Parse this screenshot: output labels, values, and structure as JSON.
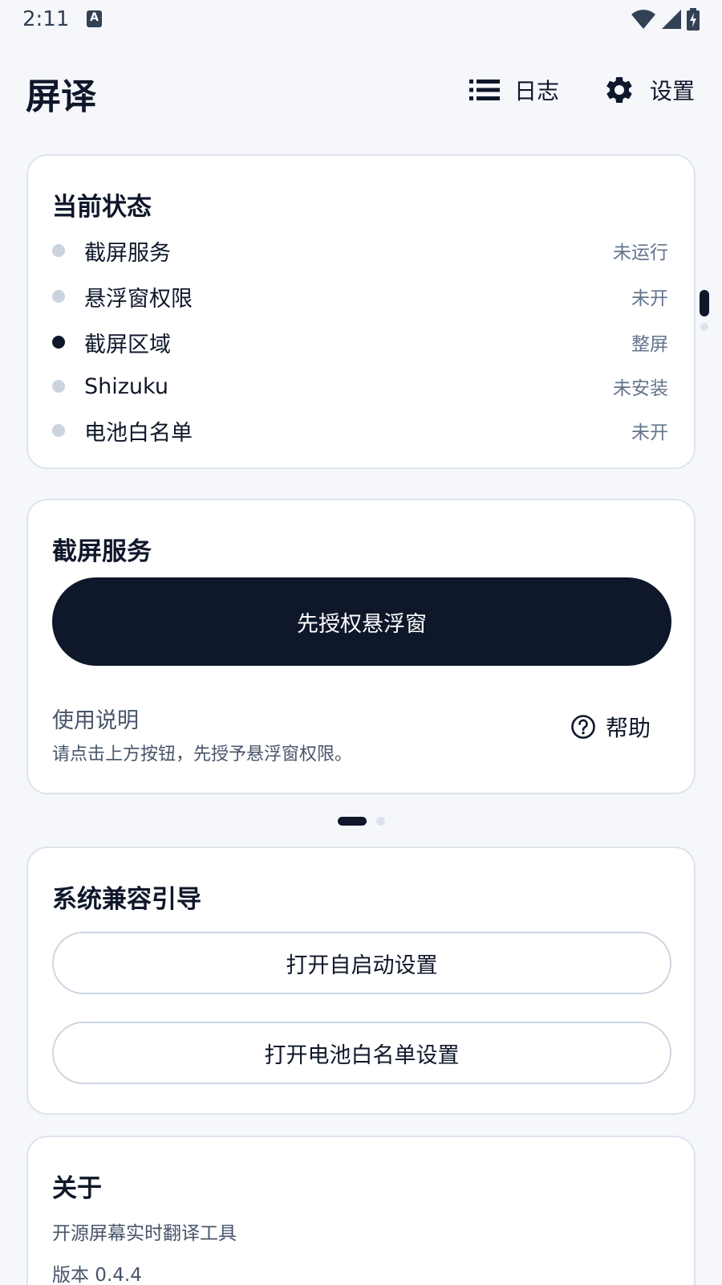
{
  "status_bar": {
    "time": "2:11",
    "notification_letter": "A"
  },
  "header": {
    "title": "屏译",
    "log_label": "日志",
    "settings_label": "设置"
  },
  "status_card": {
    "title": "当前状态",
    "rows": [
      {
        "label": "截屏服务",
        "value": "未运行",
        "active": false
      },
      {
        "label": "悬浮窗权限",
        "value": "未开",
        "active": false
      },
      {
        "label": "截屏区域",
        "value": "整屏",
        "active": true
      },
      {
        "label": "Shizuku",
        "value": "未安装",
        "active": false
      },
      {
        "label": "电池白名单",
        "value": "未开",
        "active": false
      }
    ]
  },
  "service_card": {
    "title": "截屏服务",
    "primary_button": "先授权悬浮窗",
    "info_title": "使用说明",
    "info_text": "请点击上方按钮，先授予悬浮窗权限。",
    "help_label": "帮助"
  },
  "pager": {
    "pages": 2,
    "current": 1
  },
  "compat_card": {
    "title": "系统兼容引导",
    "autostart_button": "打开自启动设置",
    "battery_button": "打开电池白名单设置"
  },
  "about_card": {
    "title": "关于",
    "description": "开源屏幕实时翻译工具",
    "version": "版本 0.4.4"
  },
  "colors": {
    "primary": "#0f172a",
    "muted": "#64748b",
    "border": "#dde3ee",
    "background": "#f5f7fb"
  }
}
